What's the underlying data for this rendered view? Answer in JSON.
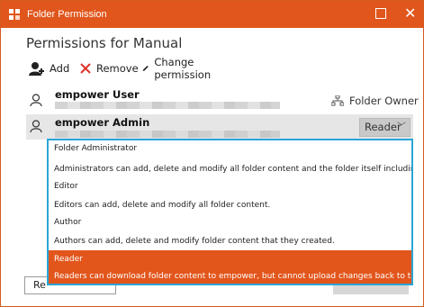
{
  "window": {
    "title": "Folder Permission"
  },
  "heading": "Permissions for Manual",
  "toolbar": {
    "add_label": "Add",
    "remove_label": "Remove",
    "change_label": "Change permission"
  },
  "users": [
    {
      "name": "empower User",
      "badge": "Folder Owner"
    },
    {
      "name": "empower Admin",
      "role": "Reader"
    }
  ],
  "dropdown": {
    "options": [
      {
        "label": "Folder Administrator",
        "description": "Administrators can add, delete and modify all folder content and the folder itself including user rights."
      },
      {
        "label": "Editor",
        "description": "Editors can add, delete and modify all folder content."
      },
      {
        "label": "Author",
        "description": "Authors can add, delete and modify folder content that they created."
      },
      {
        "label": "Reader",
        "description": "Readers can download folder content to empower, but cannot upload changes back to the folder.",
        "selected": true
      }
    ]
  },
  "behind_button": "Re",
  "colors": {
    "accent": "#e0561c",
    "focus_border": "#2aa6d6"
  },
  "icons": [
    "app-icon",
    "add-user-icon",
    "remove-icon",
    "pen-icon",
    "person-icon",
    "owner-icon",
    "chevron-down-icon",
    "maximize-icon",
    "close-icon"
  ]
}
